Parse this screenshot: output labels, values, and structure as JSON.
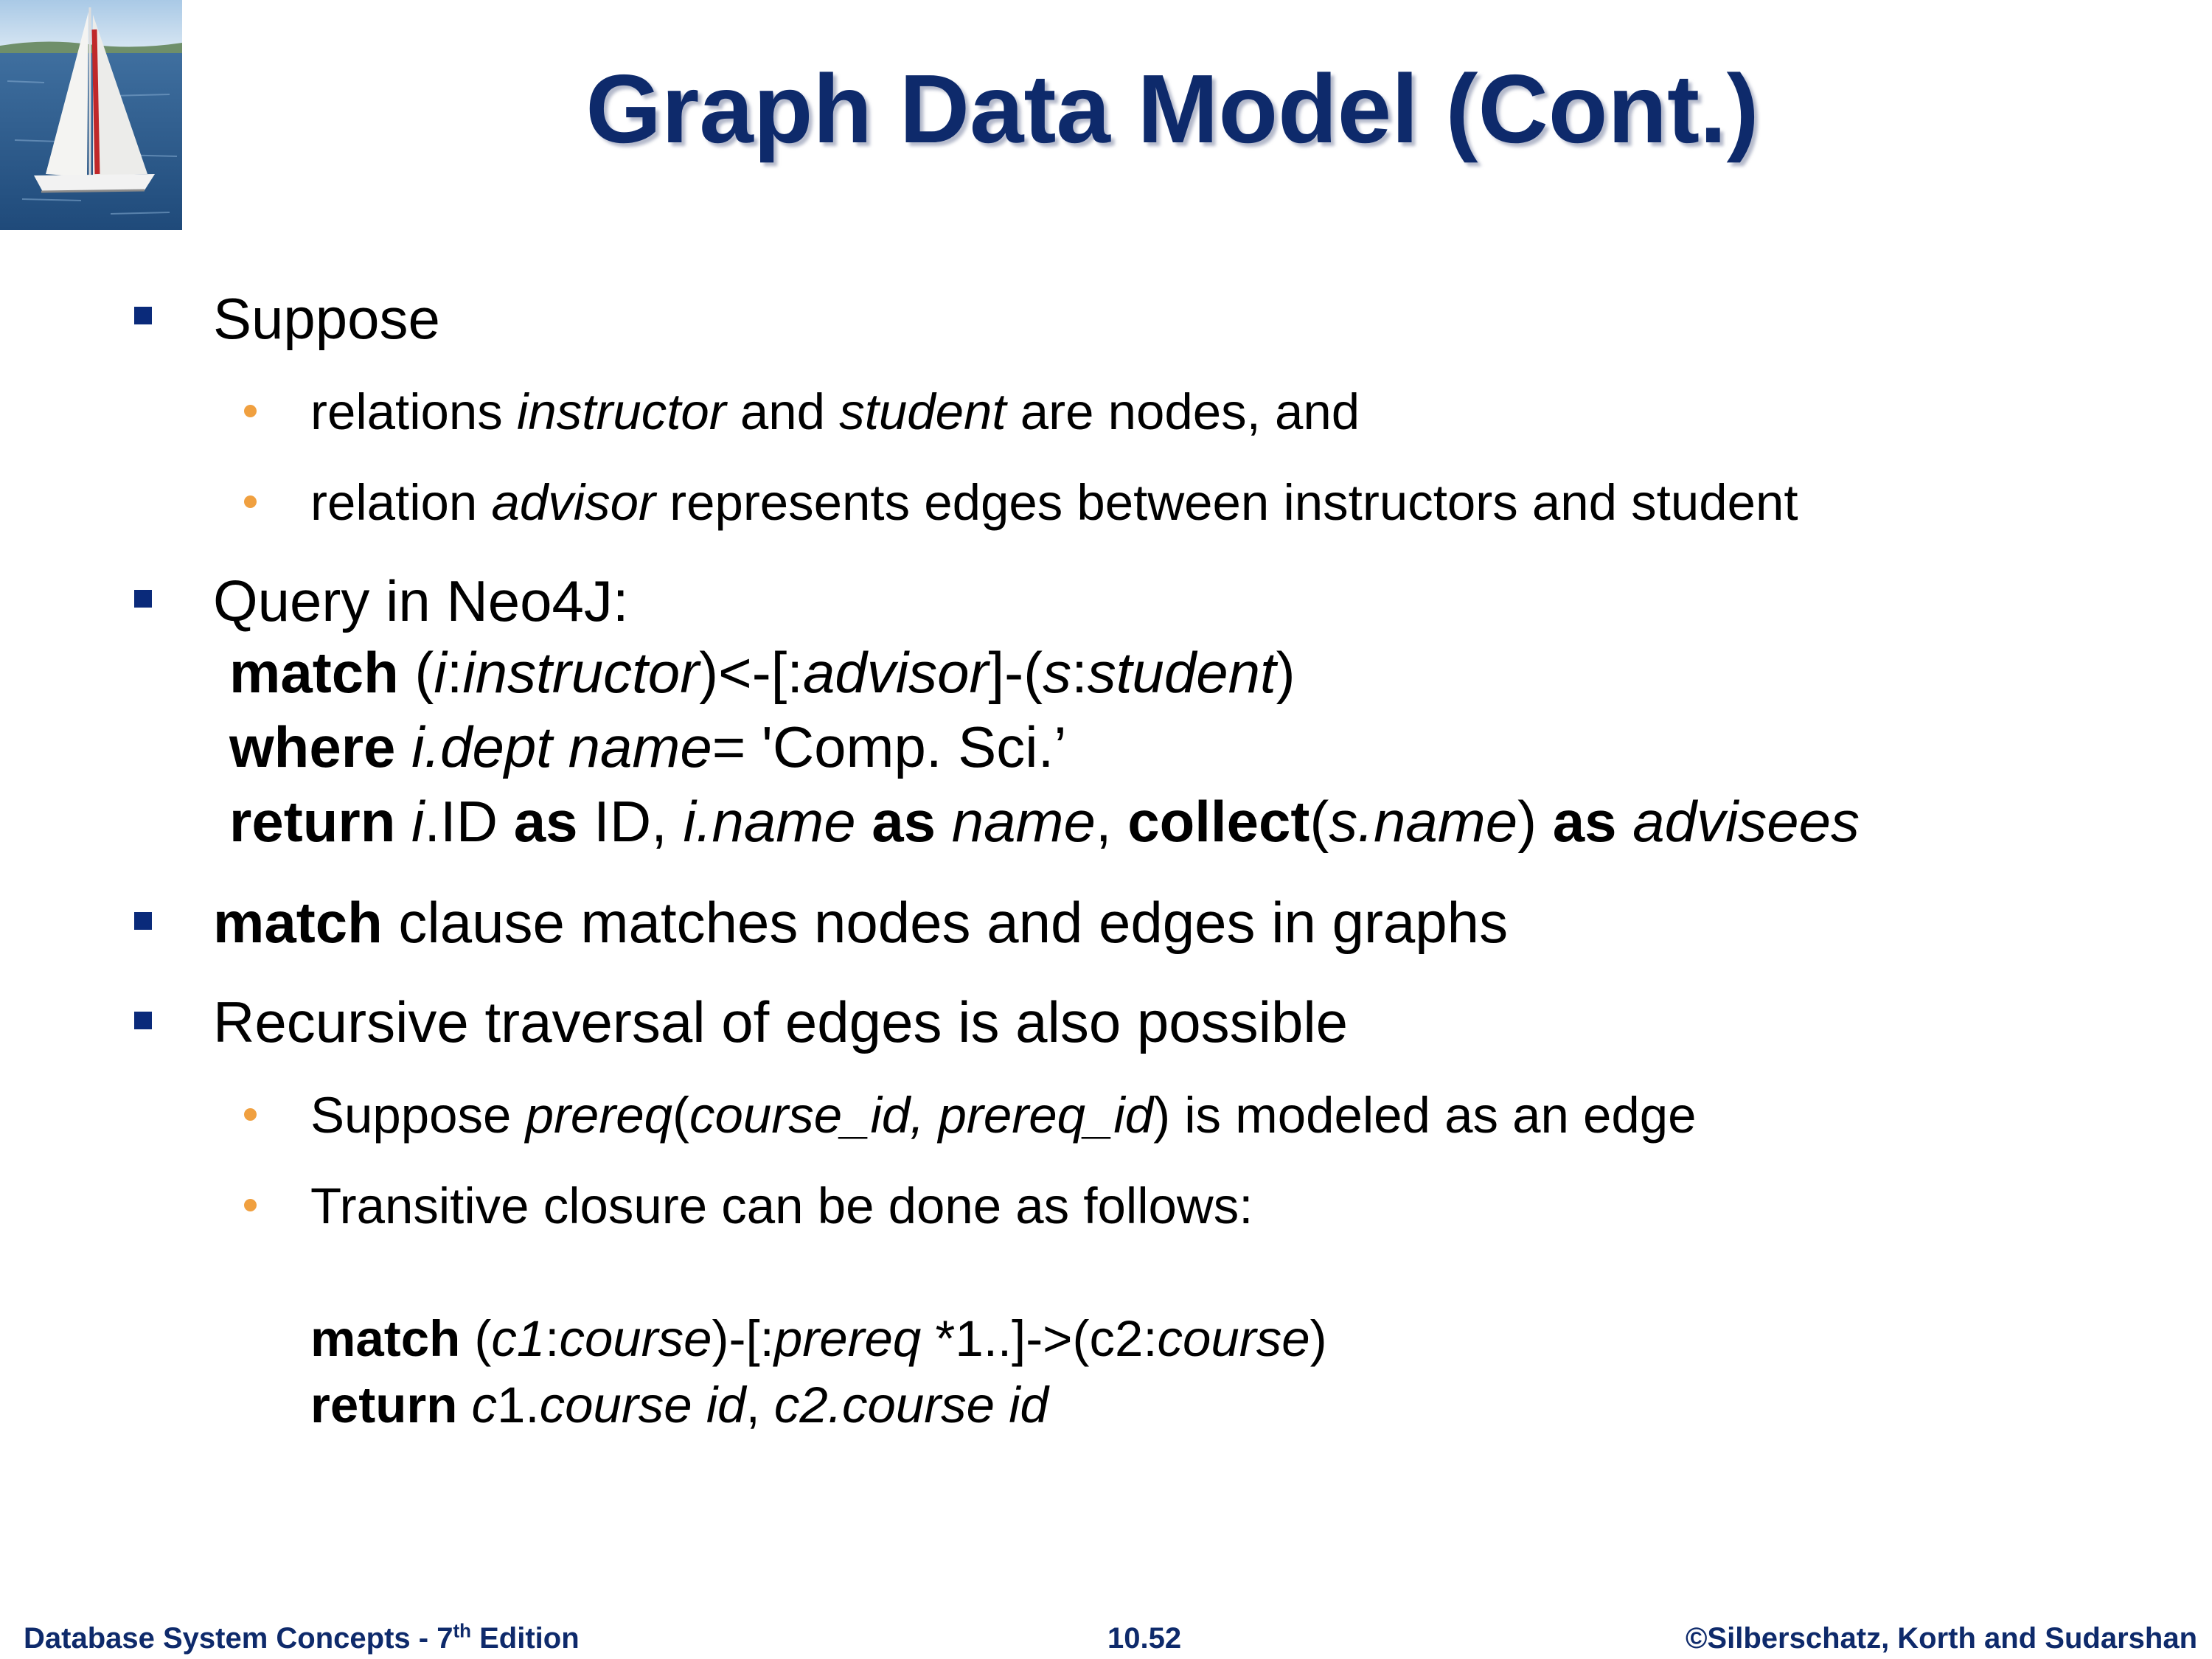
{
  "slide": {
    "title": "Graph Data Model (Cont.)",
    "logo": "sailboat-logo"
  },
  "bullets": {
    "b1": "Suppose",
    "b1_sub1": {
      "t1": "relations ",
      "t2": "instructor",
      "t3": " and ",
      "t4": "student",
      "t5": " are nodes, and"
    },
    "b1_sub2": {
      "t1": "relation ",
      "t2": "advisor",
      "t3": " represents edges between instructors and student"
    },
    "b2": "Query in Neo4J:",
    "b3": {
      "t1": "match",
      "t2": " clause matches nodes and edges in graphs"
    },
    "b4": "Recursive traversal of edges is also possible",
    "b4_sub1": {
      "t1": "Suppose ",
      "t2": "prereq",
      "t3": "(",
      "t4": "course_id, prereq_id",
      "t5": ") is modeled as an edge"
    },
    "b4_sub2": "Transitive closure can be done as follows:"
  },
  "query1": {
    "line1": {
      "k": "match",
      "p1": " (",
      "i1": "i",
      "p2": ":",
      "i2": "instructor",
      "p3": ")<-[:",
      "i3": "advisor",
      "p4": "]-(",
      "i4": "s",
      "p5": ":",
      "i5": "student",
      "p6": ")"
    },
    "line2": {
      "k": "where",
      "p1": " ",
      "i1": "i.dept name",
      "p2": "= 'Comp. Sci.’"
    },
    "line3": {
      "k": "return",
      "p1": " ",
      "i1": "i",
      "p2": ".ID ",
      "k2": "as",
      "p3": " ID, ",
      "i2": "i.name",
      "p4": " ",
      "k3": "as",
      "p5": " ",
      "i3": "name",
      "p6": ", ",
      "k4": "collect",
      "p7": "(",
      "i4": "s.name",
      "p8": ") ",
      "k5": "as",
      "p9": " ",
      "i5": "advisees"
    }
  },
  "query2": {
    "line1": {
      "k": "match",
      "p1": " (",
      "i1": "c1",
      "p2": ":",
      "i2": "course",
      "p3": ")-[:",
      "i3": "prereq",
      "p4": " *1..]->(",
      "p5": "c2:",
      "i4": "course",
      "p6": ")"
    },
    "line2": {
      "k": "return",
      "p1": " ",
      "i1": "c",
      "p2": "1.",
      "i2": "course id",
      "p3": ", ",
      "i3": "c2.course id"
    }
  },
  "footer": {
    "left_prefix": "Database System Concepts - 7",
    "left_sup": "th",
    "left_suffix": " Edition",
    "center": "10.52",
    "right": "©Silberschatz, Korth and Sudarshan"
  }
}
